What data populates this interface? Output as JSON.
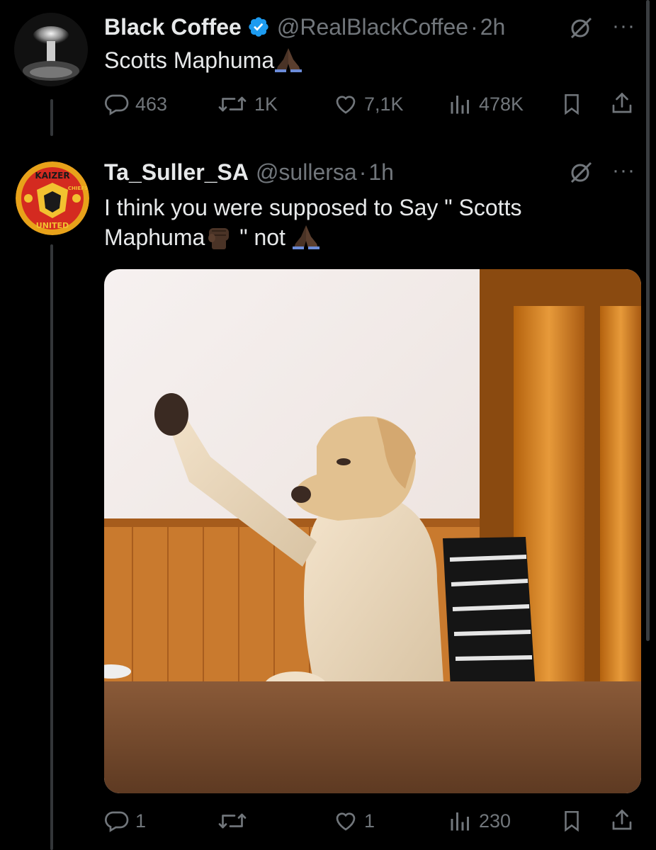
{
  "tweets": [
    {
      "name": "Black Coffee",
      "handle": "@RealBlackCoffee",
      "separator": "·",
      "time": "2h",
      "verified": true,
      "text": "Scotts Maphuma",
      "text_emoji": "folded-hands-icon",
      "actions": {
        "replies": "463",
        "reposts": "1K",
        "likes": "7,1K",
        "views": "478K"
      }
    },
    {
      "name": "Ta_Suller_SA",
      "handle": "@sullersa",
      "separator": "·",
      "time": "1h",
      "avatar_text_top": "KAIZER",
      "avatar_text_side": "CHIEFS",
      "avatar_text_bottom": "UNITED",
      "text_line1": "I think you were supposed to  Say \" Scotts",
      "text_line2_a": "Maphuma",
      "text_line2_b": " \" not ",
      "text_emojis": [
        "raised-fist-icon",
        "folded-hands-icon"
      ],
      "media": "photo of a dog at a table raising its paw",
      "actions": {
        "replies": "1",
        "reposts": "",
        "likes": "1",
        "views": "230"
      }
    }
  ],
  "colors": {
    "background": "#000000",
    "text": "#e7e9ea",
    "muted": "#71767b",
    "verified": "#1d9bf0",
    "thread_line": "#333639"
  },
  "more_label": "···"
}
